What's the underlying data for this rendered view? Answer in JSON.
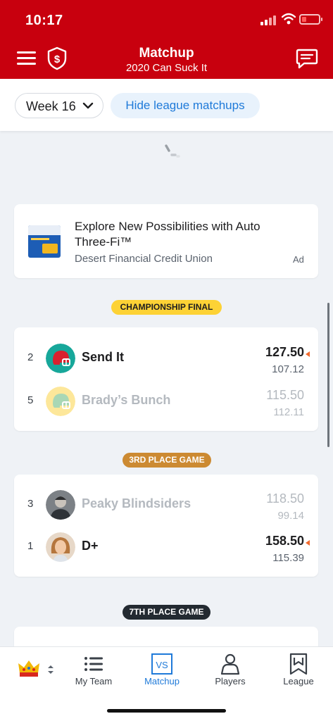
{
  "status_bar": {
    "time": "10:17"
  },
  "header": {
    "title": "Matchup",
    "subtitle": "2020 Can Suck It",
    "menu_icon": "hamburger-menu-icon",
    "shield_icon": "dollar-shield-icon",
    "chat_icon": "chat-bubble-icon"
  },
  "filters": {
    "week_label": "Week 16",
    "hide_label": "Hide league matchups"
  },
  "ad": {
    "headline": "Explore New Possibilities with Auto Three-Fi™",
    "sponsor": "Desert Financial Credit Union",
    "ad_label": "Ad"
  },
  "matchups": [
    {
      "label": "CHAMPIONSHIP FINAL",
      "teams": [
        {
          "seed": "2",
          "name": "Send It",
          "score": "127.50",
          "projected": "107.12",
          "winning": true
        },
        {
          "seed": "5",
          "name": "Brady’s Bunch",
          "score": "115.50",
          "projected": "112.11",
          "winning": false
        }
      ]
    },
    {
      "label": "3RD PLACE GAME",
      "teams": [
        {
          "seed": "3",
          "name": "Peaky Blindsiders",
          "score": "118.50",
          "projected": "99.14",
          "winning": false
        },
        {
          "seed": "1",
          "name": "D+",
          "score": "158.50",
          "projected": "115.39",
          "winning": true
        }
      ]
    },
    {
      "label": "7TH PLACE GAME",
      "teams": []
    }
  ],
  "tabs": [
    {
      "label": "My Team",
      "icon": "list-icon",
      "active": false
    },
    {
      "label": "Matchup",
      "icon": "versus-icon",
      "active": true
    },
    {
      "label": "Players",
      "icon": "player-icon",
      "active": false
    },
    {
      "label": "League",
      "icon": "league-badge-icon",
      "active": false
    }
  ],
  "colors": {
    "brand_red": "#c8000e",
    "accent_blue": "#1f7ad9",
    "gold": "#fdd235",
    "bronze": "#cc8a32",
    "dark": "#232a31"
  }
}
